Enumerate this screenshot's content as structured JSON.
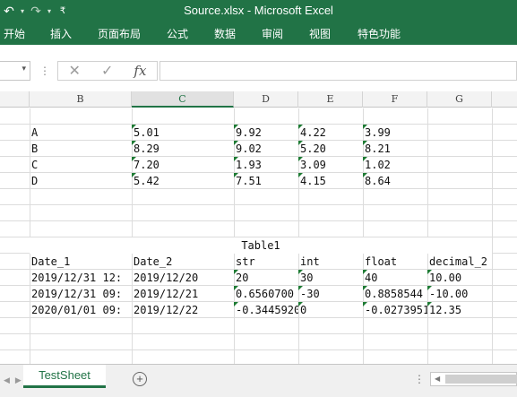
{
  "window": {
    "title": "Source.xlsx - Microsoft Excel"
  },
  "qat": {
    "undo_icon": "undo-icon",
    "redo_icon": "redo-icon",
    "customize_icon": "customize-qat-icon"
  },
  "ribbon": {
    "tabs": [
      "开始",
      "插入",
      "页面布局",
      "公式",
      "数据",
      "审阅",
      "视图",
      "特色功能"
    ]
  },
  "formula_bar": {
    "cancel_icon": "cancel-icon",
    "enter_icon": "check-icon",
    "fx_label": "fx",
    "value": ""
  },
  "columns": [
    "B",
    "C",
    "D",
    "E",
    "F",
    "G"
  ],
  "selected_column": "C",
  "cells": {
    "r2": [
      "A",
      "5.01",
      "9.92",
      "4.22",
      "3.99"
    ],
    "r3": [
      "B",
      "8.29",
      "9.02",
      "5.20",
      "8.21"
    ],
    "r4": [
      "C",
      "7.20",
      "1.93",
      "3.09",
      "1.02"
    ],
    "r5": [
      "D",
      "5.42",
      "7.51",
      "4.15",
      "8.64"
    ],
    "table_title": "Table1",
    "headers": [
      "Date_1",
      "Date_2",
      "str",
      "int",
      "float",
      "decimal_2"
    ],
    "t1": [
      "2019/12/31 12:",
      "2019/12/20",
      "20",
      "30",
      "40",
      "10.00"
    ],
    "t2": [
      "2019/12/31 09:",
      "2019/12/21",
      "0.6560700",
      "-30",
      "0.8858544",
      "-10.00"
    ],
    "t3": [
      "2020/01/01 09:",
      "2019/12/22",
      "-0.3445920",
      "0",
      "-0.0273951",
      "12.35"
    ]
  },
  "sheet_tabs": {
    "active": "TestSheet",
    "add_label": "+"
  },
  "colors": {
    "accent": "#217346",
    "flag": "#1e7b34"
  }
}
